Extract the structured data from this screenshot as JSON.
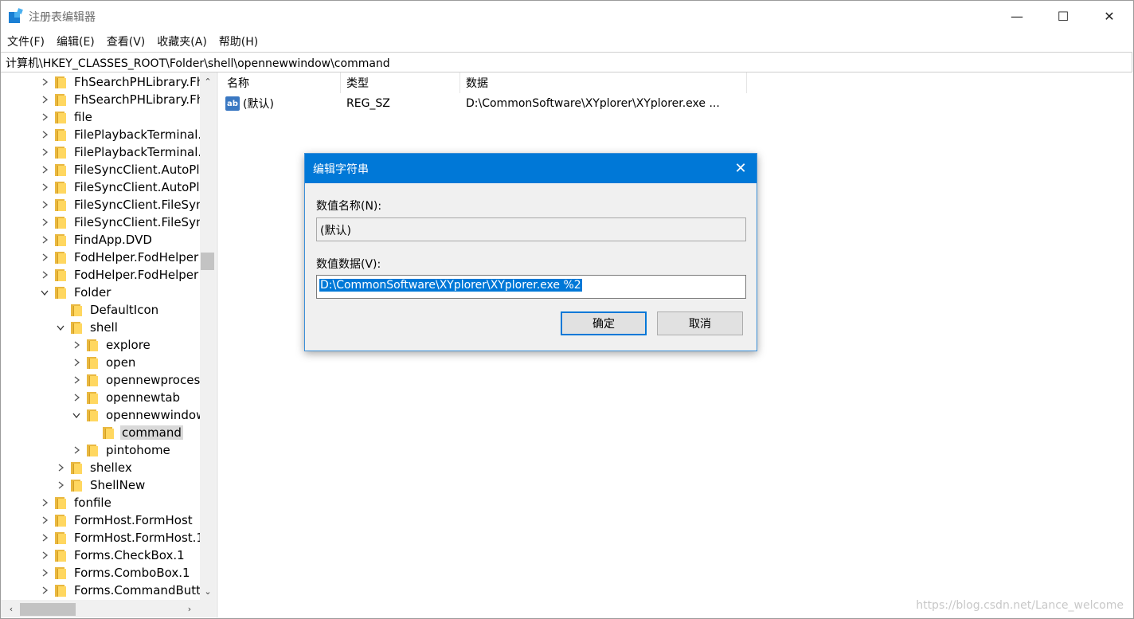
{
  "window": {
    "title": "注册表编辑器",
    "minimize_icon": "—",
    "maximize_icon": "☐",
    "close_icon": "✕"
  },
  "menu": [
    "文件(F)",
    "编辑(E)",
    "查看(V)",
    "收藏夹(A)",
    "帮助(H)"
  ],
  "address": "计算机\\HKEY_CLASSES_ROOT\\Folder\\shell\\opennewwindow\\command",
  "tree": [
    {
      "label": "FhSearchPHLibrary.Fh",
      "level": 0,
      "state": "collapsed"
    },
    {
      "label": "FhSearchPHLibrary.Fh",
      "level": 0,
      "state": "collapsed"
    },
    {
      "label": "file",
      "level": 0,
      "state": "collapsed"
    },
    {
      "label": "FilePlaybackTerminal.I",
      "level": 0,
      "state": "collapsed"
    },
    {
      "label": "FilePlaybackTerminal.I",
      "level": 0,
      "state": "collapsed"
    },
    {
      "label": "FileSyncClient.AutoPla",
      "level": 0,
      "state": "collapsed"
    },
    {
      "label": "FileSyncClient.AutoPla",
      "level": 0,
      "state": "collapsed"
    },
    {
      "label": "FileSyncClient.FileSync",
      "level": 0,
      "state": "collapsed"
    },
    {
      "label": "FileSyncClient.FileSync",
      "level": 0,
      "state": "collapsed"
    },
    {
      "label": "FindApp.DVD",
      "level": 0,
      "state": "collapsed"
    },
    {
      "label": "FodHelper.FodHelper",
      "level": 0,
      "state": "collapsed"
    },
    {
      "label": "FodHelper.FodHelper",
      "level": 0,
      "state": "collapsed"
    },
    {
      "label": "Folder",
      "level": 0,
      "state": "expanded"
    },
    {
      "label": "DefaultIcon",
      "level": 1,
      "state": "leaf"
    },
    {
      "label": "shell",
      "level": 1,
      "state": "expanded"
    },
    {
      "label": "explore",
      "level": 2,
      "state": "collapsed"
    },
    {
      "label": "open",
      "level": 2,
      "state": "collapsed"
    },
    {
      "label": "opennewproces",
      "level": 2,
      "state": "collapsed"
    },
    {
      "label": "opennewtab",
      "level": 2,
      "state": "collapsed"
    },
    {
      "label": "opennewwindow",
      "level": 2,
      "state": "expanded"
    },
    {
      "label": "command",
      "level": 3,
      "state": "leaf",
      "selected": true
    },
    {
      "label": "pintohome",
      "level": 2,
      "state": "collapsed"
    },
    {
      "label": "shellex",
      "level": 1,
      "state": "collapsed"
    },
    {
      "label": "ShellNew",
      "level": 1,
      "state": "collapsed"
    },
    {
      "label": "fonfile",
      "level": 0,
      "state": "collapsed"
    },
    {
      "label": "FormHost.FormHost",
      "level": 0,
      "state": "collapsed"
    },
    {
      "label": "FormHost.FormHost.1",
      "level": 0,
      "state": "collapsed"
    },
    {
      "label": "Forms.CheckBox.1",
      "level": 0,
      "state": "collapsed"
    },
    {
      "label": "Forms.ComboBox.1",
      "level": 0,
      "state": "collapsed"
    },
    {
      "label": "Forms.CommandButto",
      "level": 0,
      "state": "collapsed"
    }
  ],
  "list": {
    "columns": [
      "名称",
      "类型",
      "数据"
    ],
    "rows": [
      {
        "icon": "ab",
        "name": "(默认)",
        "type": "REG_SZ",
        "data": "D:\\CommonSoftware\\XYplorer\\XYplorer.exe ..."
      }
    ]
  },
  "dialog": {
    "title": "编辑字符串",
    "close_icon": "✕",
    "name_label": "数值名称(N):",
    "name_value": "(默认)",
    "data_label": "数值数据(V):",
    "data_value": "D:\\CommonSoftware\\XYplorer\\XYplorer.exe %2",
    "ok_label": "确定",
    "cancel_label": "取消"
  },
  "scroll": {
    "up": "⌃",
    "down": "⌄",
    "left": "‹",
    "right": "›"
  },
  "watermark": "https://blog.csdn.net/Lance_welcome"
}
